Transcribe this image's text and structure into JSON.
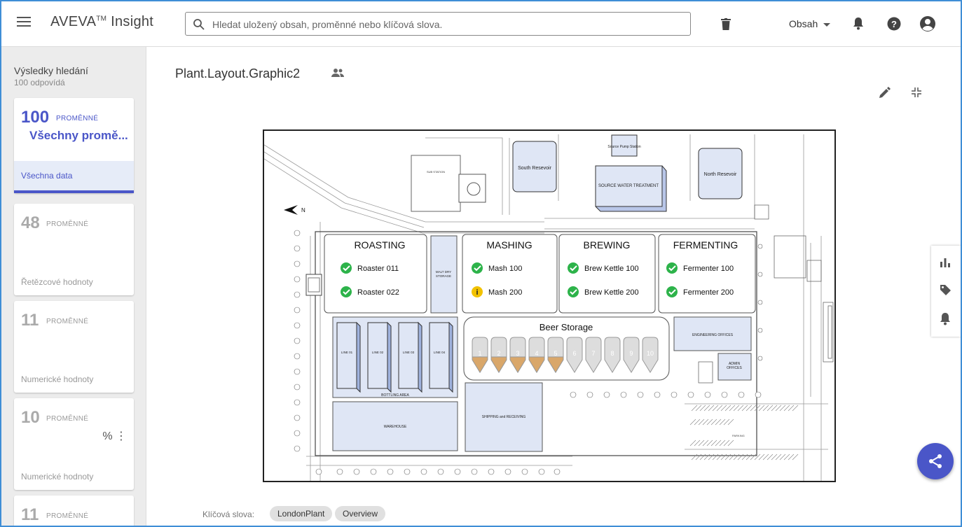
{
  "app": {
    "name": "AVEVA",
    "tm": "TM",
    "suffix": " Insight"
  },
  "search": {
    "placeholder": "Hledat uložený obsah, proměnné nebo klíčová slova."
  },
  "header": {
    "content_menu": "Obsah"
  },
  "sidebar": {
    "title": "Výsledky hledání",
    "subtitle": "100 odpovídá",
    "cards": [
      {
        "count": "100",
        "unit": "PROMĚNNÉ",
        "name": "Všechny promě...",
        "link": "Všechna data",
        "active": true
      },
      {
        "count": "48",
        "unit": "PROMĚNNÉ",
        "footer": "Řetězcové hodnoty"
      },
      {
        "count": "11",
        "unit": "PROMĚNNÉ",
        "footer": "Numerické hodnoty"
      },
      {
        "count": "10",
        "unit": "PROMĚNNÉ",
        "extra": "% ⋮",
        "footer": "Numerické hodnoty"
      },
      {
        "count": "11",
        "unit": "PROMĚNNÉ"
      }
    ]
  },
  "main": {
    "title": "Plant.Layout.Graphic2",
    "keywords_label": "Klíčová slova:",
    "keywords": [
      "LondonPlant",
      "Overview"
    ]
  },
  "graphic": {
    "areas": {
      "roasting": {
        "title": "ROASTING",
        "items": [
          {
            "label": "Roaster 011",
            "status": "ok"
          },
          {
            "label": "Roaster 022",
            "status": "ok"
          }
        ]
      },
      "mashing": {
        "title": "MASHING",
        "items": [
          {
            "label": "Mash 100",
            "status": "ok"
          },
          {
            "label": "Mash 200",
            "status": "warning"
          }
        ]
      },
      "brewing": {
        "title": "BREWING",
        "items": [
          {
            "label": "Brew Kettle 100",
            "status": "ok"
          },
          {
            "label": "Brew Kettle 200",
            "status": "ok"
          }
        ]
      },
      "fermenting": {
        "title": "FERMENTING",
        "items": [
          {
            "label": "Fermenter 100",
            "status": "ok"
          },
          {
            "label": "Fermenter 200",
            "status": "ok"
          }
        ]
      }
    },
    "beer_storage": {
      "title": "Beer Storage",
      "tanks": [
        "1",
        "2",
        "3",
        "4",
        "5",
        "6",
        "7",
        "8",
        "9",
        "10"
      ],
      "filled_tanks": 5
    },
    "labels": {
      "malt": "MALT DRY\nSTORAGE",
      "south_reservoir": "South Resevoir",
      "north_reservoir": "North Resevoir",
      "source_pump": "Source Pump Station",
      "source_water": "SOURCE WATER TREATMENT",
      "engineering": "ENGINEERING OFFICES",
      "admin": "ADMIN OFFICES",
      "bottling": "BOTTLING AREA",
      "warehouse": "WAREHOUSE",
      "shipping": "SHIPPING and RECEIVING",
      "lines": [
        "LINE 01",
        "LINE 02",
        "LINE 03",
        "LINE 04"
      ],
      "north": "N",
      "sub_station": "SUB STATION",
      "parking": "PARKING"
    }
  },
  "colors": {
    "accent": "#4a56c8",
    "ok": "#2db34a",
    "warning": "#f2c200",
    "tank_fill": "#d9a76a"
  },
  "icons": [
    "menu-icon",
    "search-icon",
    "trash-icon",
    "bell-icon",
    "help-icon",
    "account-icon",
    "people-icon",
    "pencil-icon",
    "shrink-icon",
    "chart-icon",
    "tag-icon",
    "share-icon"
  ]
}
